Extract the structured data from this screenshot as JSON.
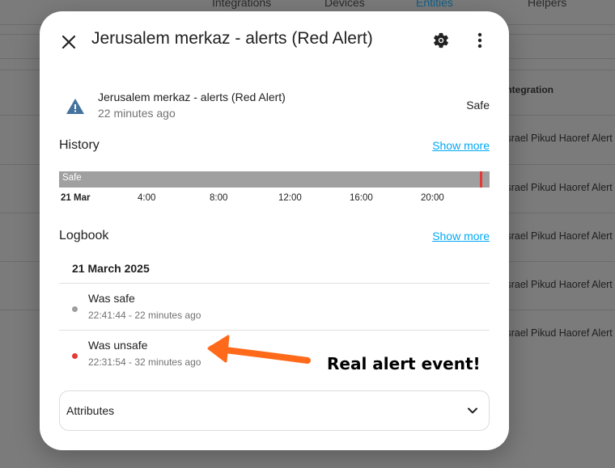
{
  "background": {
    "tabs": [
      {
        "label": "Integrations"
      },
      {
        "label": "Devices"
      },
      {
        "label": "Entities"
      },
      {
        "label": "Helpers"
      }
    ],
    "column_header": "Integration",
    "row_texts": [
      "Israel Pikud Haoref Alert",
      "Israel Pikud Haoref Alert",
      "Israel Pikud Haoref Alert",
      "Israel Pikud Haoref Alert",
      "Israel Pikud Haoref Alert"
    ]
  },
  "dialog": {
    "title": "Jerusalem merkaz - alerts (Red Alert)",
    "close_icon": "close-icon",
    "settings_icon": "gear-icon",
    "more_icon": "more-vertical-icon",
    "entity": {
      "icon": "alert-triangle-icon",
      "name": "Jerusalem merkaz - alerts (Red Alert)",
      "last_changed": "22 minutes ago",
      "state": "Safe"
    },
    "history": {
      "title": "History",
      "show_more": "Show more",
      "bar_label": "Safe",
      "bar_color": "#a0a0a0",
      "marker_color": "#e53935",
      "ticks": [
        "21 Mar",
        "4:00",
        "8:00",
        "12:00",
        "16:00",
        "20:00"
      ]
    },
    "logbook": {
      "title": "Logbook",
      "show_more": "Show more",
      "date": "21 March 2025",
      "entries": [
        {
          "title": "Was safe",
          "subtitle": "22:41:44 - 22 minutes ago",
          "dot_color": "#9e9e9e"
        },
        {
          "title": "Was unsafe",
          "subtitle": "22:31:54 - 32 minutes ago",
          "dot_color": "#e53935"
        }
      ]
    },
    "attributes": {
      "label": "Attributes",
      "chevron_icon": "chevron-down-icon"
    }
  },
  "annotation": {
    "text": "Real alert event!",
    "arrow_color": "#ff6a1a"
  },
  "colors": {
    "link": "#03a9f4",
    "entity_icon": "#44739e"
  }
}
